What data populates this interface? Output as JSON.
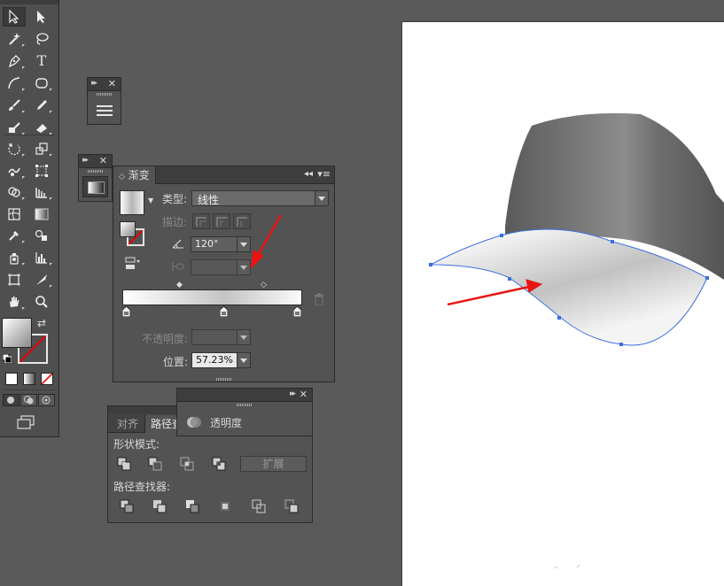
{
  "gradient_panel": {
    "tab_label": "渐变",
    "type_label": "类型:",
    "type_value": "线性",
    "stroke_label": "描边:",
    "angle_value": "120°",
    "opacity_label": "不透明度:",
    "opacity_value": "",
    "location_label": "位置:",
    "location_value": "57.23%",
    "stops_percent": [
      0,
      57.23,
      100
    ]
  },
  "pathfinder_panel": {
    "tab_align": "对齐",
    "tab_pathfinder": "路径查",
    "shape_modes_label": "形状模式:",
    "expand_button": "扩展",
    "pathfinders_label": "路径查找器:"
  },
  "transparency_panel": {
    "label": "透明度"
  },
  "tools": {
    "type_tool_glyph": "T"
  },
  "colors": {
    "ui_bg": "#5a5a5a",
    "panel_bg": "#535353",
    "artboard": "#ffffff",
    "annotation_arrow": "#e81414",
    "path_outline": "#3b6fe0"
  }
}
